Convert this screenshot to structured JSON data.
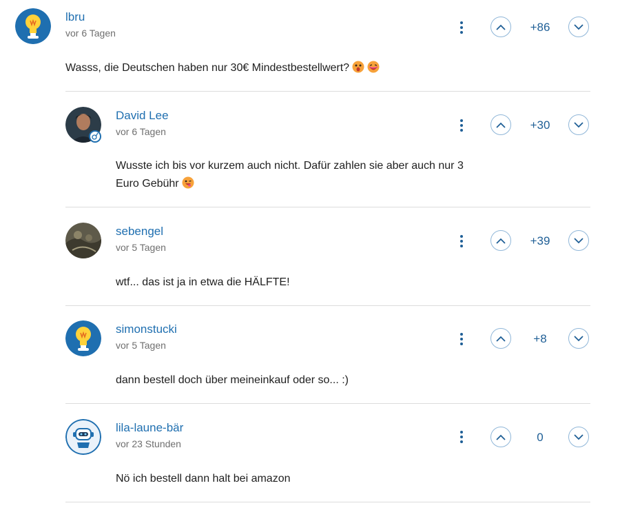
{
  "comments": [
    {
      "author": "lbru",
      "time": "vor 6 Tagen",
      "score": "+86",
      "text": "Wasss, die Deutschen haben nur 30€ Mindestbestellwert?",
      "emojis": [
        "surprised-emoji",
        "laughing-emoji"
      ],
      "avatar": "bulb-avatar"
    },
    {
      "author": "David Lee",
      "time": "vor 6 Tagen",
      "score": "+30",
      "text_lines": [
        "Wusste ich bis vor kurzem auch nicht. Dafür zahlen sie aber auch nur 3",
        "Euro Gebühr"
      ],
      "emojis": [
        "grinning-emoji"
      ],
      "avatar": "photo-avatar"
    },
    {
      "author": "sebengel",
      "time": "vor 5 Tagen",
      "score": "+39",
      "text": "wtf... das ist ja in etwa die HÄLFTE!",
      "avatar": "photo-avatar"
    },
    {
      "author": "simonstucki",
      "time": "vor 5 Tagen",
      "score": "+8",
      "text": "dann bestell doch über meineinkauf oder so... :)",
      "avatar": "bulb-avatar"
    },
    {
      "author": "lila-laune-bär",
      "time": "vor 23 Stunden",
      "score": "0",
      "text": "Nö ich bestell dann halt bei amazon",
      "avatar": "robot-avatar"
    }
  ],
  "colors": {
    "link": "#1f6fb0",
    "score": "#1f5f96",
    "divider": "#dcdcdc",
    "vote_border": "#8fb6d8"
  }
}
